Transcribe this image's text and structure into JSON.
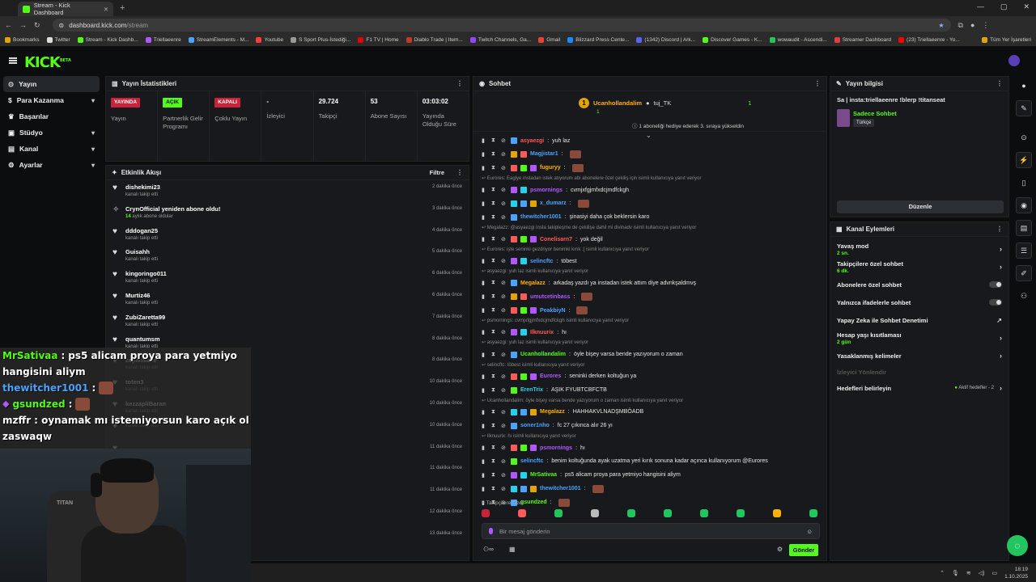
{
  "browser": {
    "tab_title": "Stream - Kick Dashboard",
    "url_host": "dashboard.kick.com",
    "url_path": "/stream",
    "bookmarks": [
      "Bookmarks",
      "Twitter",
      "Stream - Kick Dashb...",
      "Triellaeenre",
      "StreamElements - M...",
      "Youtube",
      "S Sport Plus-İstediği...",
      "F1 TV | Home",
      "Diablo Trade | Item...",
      "Twitch Channels, Ga...",
      "Gmail",
      "Blizzard Press Cente...",
      "(1342) Discord | Ark...",
      "Discover Games - K...",
      "wowaudit - Ascendi...",
      "Streamer Dashboard",
      "(23) Triellaeenre - Yo...",
      "Tüm Yer İşaretleri"
    ]
  },
  "header": {
    "logo": "KICK",
    "logo_badge": "BETA"
  },
  "sidebar": {
    "items": [
      {
        "label": "Yayın"
      },
      {
        "label": "Para Kazanma"
      },
      {
        "label": "Başarılar"
      },
      {
        "label": "Stüdyo"
      },
      {
        "label": "Kanal"
      },
      {
        "label": "Ayarlar"
      }
    ]
  },
  "stats": {
    "title": "Yayın İstatistikleri",
    "cells": [
      {
        "badge": "YAYINDA",
        "label": "Yayın"
      },
      {
        "badge": "AÇIK",
        "label": "Partnerlik Gelir Programı"
      },
      {
        "badge": "KAPALI",
        "label": "Çoklu Yayın"
      },
      {
        "value": "-",
        "label": "İzleyici"
      },
      {
        "value": "29.724",
        "label": "Takipçi"
      },
      {
        "value": "53",
        "label": "Abone Sayısı"
      },
      {
        "value": "03:03:02",
        "label": "Yayında Olduğu Süre"
      }
    ]
  },
  "activity": {
    "title": "Etkinlik Akışı",
    "filter": "Filtre",
    "items": [
      {
        "name": "dishekimi23",
        "sub": "kanalı takip etti",
        "time": "2 dakika önce"
      },
      {
        "name": "CrynOfficial yeniden abone oldu!",
        "sub_num": "14",
        "sub": "aylık abone oldular",
        "time": "3 dakika önce"
      },
      {
        "name": "dddogan25",
        "sub": "kanalı takip etti",
        "time": "4 dakika önce"
      },
      {
        "name": "Guisahh",
        "sub": "kanalı takip etti",
        "time": "5 dakika önce"
      },
      {
        "name": "kingoringo011",
        "sub": "kanalı takip etti",
        "time": "6 dakika önce"
      },
      {
        "name": "Murtiz46",
        "sub": "kanalı takip etti",
        "time": "6 dakika önce"
      },
      {
        "name": "ZubiZaretta99",
        "sub": "kanalı takip etti",
        "time": "7 dakika önce"
      },
      {
        "name": "quantumsm",
        "sub": "kanalı takip etti",
        "time": "8 dakika önce"
      },
      {
        "name": "zeytinsufle",
        "sub": "kanalı takip etti",
        "time": "8 dakika önce"
      },
      {
        "name": "toten3",
        "sub": "kanalı takip etti",
        "time": "10 dakika önce"
      },
      {
        "name": "kezzapliBaran",
        "sub": "kanalı takip etti",
        "time": "10 dakika önce"
      },
      {
        "name": "",
        "sub": "kanalı takip etti",
        "time": "10 dakika önce"
      },
      {
        "name": "",
        "sub": "",
        "time": "11 dakika önce"
      },
      {
        "name": "",
        "sub": "",
        "time": "11 dakika önce"
      },
      {
        "name": "",
        "sub": "",
        "time": "11 dakika önce"
      },
      {
        "name": "",
        "sub": "",
        "time": "12 dakika önce"
      },
      {
        "name": "",
        "sub": "",
        "time": "13 dakika önce"
      }
    ]
  },
  "overlay": {
    "lines": [
      {
        "user": "MrSativaa",
        "text": "ps5 alicam proya para yetmiyo"
      },
      {
        "user": "",
        "text": "hangisini aliym"
      },
      {
        "user": "thewitcher1001",
        "text": ":"
      },
      {
        "user": "gsundzed",
        "text": ":"
      },
      {
        "user": "mzffr",
        "text": ": oynamak mı istemiyorsun karo açık ol"
      },
      {
        "user": "",
        "text": "zaswaqw"
      }
    ],
    "chair_brand": "TITAN"
  },
  "chat": {
    "title": "Sohbet",
    "pinned": {
      "name": "Ucanhollandalim",
      "other": "tuj_TK",
      "count_left": "1",
      "count_right": "1",
      "line": "1 aboneliği hediye ederek 3. sıraya yükseldin"
    },
    "messages": [
      {
        "user": "asyaezgi",
        "text": "yuh laz",
        "color": "#ff5a5a"
      },
      {
        "user": "Magjistar1",
        "text": "",
        "color": "#4aa3ff"
      },
      {
        "user": "fuguryy",
        "text": "",
        "color": "#ffb100"
      },
      {
        "reply": "Eurores: Eaglye instadan istek atıyorum abi abonelere özel çekiliş için isimli kullanıcıya yanıt veriyor"
      },
      {
        "user": "psmornings",
        "text": "cvmjxfgjmfxdcjmdfckgh",
        "color": "#b057ff"
      },
      {
        "user": "x_dumarz",
        "text": "",
        "color": "#4aa3ff"
      },
      {
        "user": "thewitcher1001",
        "text": "şinasiyi daha çok beklersin karo",
        "color": "#4aa3ff"
      },
      {
        "reply": "Megalazz: @asyaezgi insta takipleşme de çekilişe dahil mi divinadv isimli kullanıcıya yanıt veriyor"
      },
      {
        "user": "Conelisarn7",
        "text": "yok değil",
        "color": "#ff5a5a"
      },
      {
        "reply": "Eurores: işte seninki gezdriyor benimki kırık :[ isimli kullanıcıya yanıt veriyor"
      },
      {
        "user": "selincftc",
        "text": "töbest",
        "color": "#4aa3ff"
      },
      {
        "reply": "asyaezgi: yuh laz isimli kullanıcıya yanıt veriyor"
      },
      {
        "user": "Megalazz",
        "text": "arkadaş yazdı ya instadan istek attım diye advnkşaldmvş",
        "color": "#ffb100"
      },
      {
        "user": "umutcetinbass",
        "text": "",
        "color": "#b057ff"
      },
      {
        "user": "PeakbiyN",
        "text": "",
        "color": "#4aa3ff"
      },
      {
        "reply": "psmornings: cvmjxfgjmfxdcjmdfckgh isimli kullanıcıya yanıt veriyor"
      },
      {
        "user": "Ilknuurix",
        "text": "hı",
        "color": "#ff5a5a"
      },
      {
        "reply": "asyaezgi: yuh laz isimli kullanıcıya yanıt veriyor"
      },
      {
        "user": "Ucanhollandalim",
        "text": "öyle bişey varsa bende yazıyorum o zaman",
        "color": "#53fc18"
      },
      {
        "reply": "selincftc: töbest isimli kullanıcıya yanıt veriyor"
      },
      {
        "user": "Eurores",
        "text": "seninki derken koltuğun ya",
        "color": "#b057ff"
      },
      {
        "user": "ErenTrix",
        "text": "AŞIK FYUBTCBFCTB",
        "color": "#22d3ee"
      },
      {
        "reply": "Ucanhollandalim: öyle bişey varsa bende yazıyorum o zaman isimli kullanıcıya yanıt veriyor"
      },
      {
        "user": "Megalazz",
        "text": "HAHHAKVLNADŞMBÖADB",
        "color": "#ffb100"
      },
      {
        "user": "soner1nho",
        "text": "fc 27 çıkınca alır 26 yı",
        "color": "#4aa3ff"
      },
      {
        "reply": "Ilknuurix: hı isimli kullanıcıya yanıt veriyor"
      },
      {
        "user": "psmornings",
        "text": "hı",
        "color": "#b057ff"
      },
      {
        "user": "selincftc",
        "text": "benim koltuğunda ayak uzatma yeri kırık sonuna kadar açınca kullanıyorum @Eurores",
        "color": "#4aa3ff"
      },
      {
        "user": "MrSativaa",
        "text": "ps5 alicam proya para yetmiyo hangisini aliym",
        "color": "#53fc18"
      },
      {
        "user": "thewitcher1001",
        "text": "",
        "color": "#4aa3ff"
      },
      {
        "user": "gsundzed",
        "text": "",
        "color": "#53fc18"
      },
      {
        "user": "mzffr",
        "text": "oynamak mı istemiyorsun karo açık ol zaswaqw",
        "color": "#e6e6e6"
      }
    ],
    "followers_only": "Takipçilere Özel",
    "input_placeholder": "Bir mesaj gönderin",
    "send": "Gönder"
  },
  "info": {
    "title": "Yayın bilgisi",
    "stream_title": "Sa | insta:triellaeenre !blerp !titanseat",
    "category": "Sadece Sohbet",
    "language": "Türkçe",
    "edit": "Düzenle"
  },
  "channel_actions": {
    "title": "Kanal Eylemleri",
    "items": [
      {
        "label": "Yavaş mod",
        "sub": "2 sn."
      },
      {
        "label": "Takipçilere özel sohbet",
        "sub": "6 dk."
      },
      {
        "label": "Abonelere özel sohbet"
      },
      {
        "label": "Yalnızca ifadelerle sohbet"
      },
      {
        "label": "Yapay Zeka ile Sohbet Denetimi"
      },
      {
        "label": "Hesap yaşı kısıtlaması",
        "sub": "2 gün"
      },
      {
        "label": "Yasaklanmış kelimeler"
      },
      {
        "label": "İzleyici Yönlendir"
      },
      {
        "label": "Hedefleri belirleyin",
        "right": "Aktif hedefler - 2"
      }
    ]
  },
  "taskbar": {
    "time": "18:19",
    "date": "1.10.2025"
  },
  "colors": {
    "accent": "#53fc18",
    "live": "#c8233a",
    "panel": "#18191c"
  }
}
